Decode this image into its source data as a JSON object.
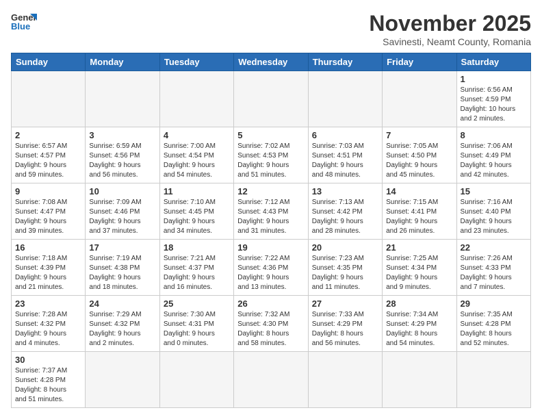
{
  "logo": {
    "line1": "General",
    "line2": "Blue"
  },
  "title": "November 2025",
  "location": "Savinesti, Neamt County, Romania",
  "weekdays": [
    "Sunday",
    "Monday",
    "Tuesday",
    "Wednesday",
    "Thursday",
    "Friday",
    "Saturday"
  ],
  "weeks": [
    [
      {
        "day": "",
        "info": ""
      },
      {
        "day": "",
        "info": ""
      },
      {
        "day": "",
        "info": ""
      },
      {
        "day": "",
        "info": ""
      },
      {
        "day": "",
        "info": ""
      },
      {
        "day": "",
        "info": ""
      },
      {
        "day": "1",
        "info": "Sunrise: 6:56 AM\nSunset: 4:59 PM\nDaylight: 10 hours\nand 2 minutes."
      }
    ],
    [
      {
        "day": "2",
        "info": "Sunrise: 6:57 AM\nSunset: 4:57 PM\nDaylight: 9 hours\nand 59 minutes."
      },
      {
        "day": "3",
        "info": "Sunrise: 6:59 AM\nSunset: 4:56 PM\nDaylight: 9 hours\nand 56 minutes."
      },
      {
        "day": "4",
        "info": "Sunrise: 7:00 AM\nSunset: 4:54 PM\nDaylight: 9 hours\nand 54 minutes."
      },
      {
        "day": "5",
        "info": "Sunrise: 7:02 AM\nSunset: 4:53 PM\nDaylight: 9 hours\nand 51 minutes."
      },
      {
        "day": "6",
        "info": "Sunrise: 7:03 AM\nSunset: 4:51 PM\nDaylight: 9 hours\nand 48 minutes."
      },
      {
        "day": "7",
        "info": "Sunrise: 7:05 AM\nSunset: 4:50 PM\nDaylight: 9 hours\nand 45 minutes."
      },
      {
        "day": "8",
        "info": "Sunrise: 7:06 AM\nSunset: 4:49 PM\nDaylight: 9 hours\nand 42 minutes."
      }
    ],
    [
      {
        "day": "9",
        "info": "Sunrise: 7:08 AM\nSunset: 4:47 PM\nDaylight: 9 hours\nand 39 minutes."
      },
      {
        "day": "10",
        "info": "Sunrise: 7:09 AM\nSunset: 4:46 PM\nDaylight: 9 hours\nand 37 minutes."
      },
      {
        "day": "11",
        "info": "Sunrise: 7:10 AM\nSunset: 4:45 PM\nDaylight: 9 hours\nand 34 minutes."
      },
      {
        "day": "12",
        "info": "Sunrise: 7:12 AM\nSunset: 4:43 PM\nDaylight: 9 hours\nand 31 minutes."
      },
      {
        "day": "13",
        "info": "Sunrise: 7:13 AM\nSunset: 4:42 PM\nDaylight: 9 hours\nand 28 minutes."
      },
      {
        "day": "14",
        "info": "Sunrise: 7:15 AM\nSunset: 4:41 PM\nDaylight: 9 hours\nand 26 minutes."
      },
      {
        "day": "15",
        "info": "Sunrise: 7:16 AM\nSunset: 4:40 PM\nDaylight: 9 hours\nand 23 minutes."
      }
    ],
    [
      {
        "day": "16",
        "info": "Sunrise: 7:18 AM\nSunset: 4:39 PM\nDaylight: 9 hours\nand 21 minutes."
      },
      {
        "day": "17",
        "info": "Sunrise: 7:19 AM\nSunset: 4:38 PM\nDaylight: 9 hours\nand 18 minutes."
      },
      {
        "day": "18",
        "info": "Sunrise: 7:21 AM\nSunset: 4:37 PM\nDaylight: 9 hours\nand 16 minutes."
      },
      {
        "day": "19",
        "info": "Sunrise: 7:22 AM\nSunset: 4:36 PM\nDaylight: 9 hours\nand 13 minutes."
      },
      {
        "day": "20",
        "info": "Sunrise: 7:23 AM\nSunset: 4:35 PM\nDaylight: 9 hours\nand 11 minutes."
      },
      {
        "day": "21",
        "info": "Sunrise: 7:25 AM\nSunset: 4:34 PM\nDaylight: 9 hours\nand 9 minutes."
      },
      {
        "day": "22",
        "info": "Sunrise: 7:26 AM\nSunset: 4:33 PM\nDaylight: 9 hours\nand 7 minutes."
      }
    ],
    [
      {
        "day": "23",
        "info": "Sunrise: 7:28 AM\nSunset: 4:32 PM\nDaylight: 9 hours\nand 4 minutes."
      },
      {
        "day": "24",
        "info": "Sunrise: 7:29 AM\nSunset: 4:32 PM\nDaylight: 9 hours\nand 2 minutes."
      },
      {
        "day": "25",
        "info": "Sunrise: 7:30 AM\nSunset: 4:31 PM\nDaylight: 9 hours\nand 0 minutes."
      },
      {
        "day": "26",
        "info": "Sunrise: 7:32 AM\nSunset: 4:30 PM\nDaylight: 8 hours\nand 58 minutes."
      },
      {
        "day": "27",
        "info": "Sunrise: 7:33 AM\nSunset: 4:29 PM\nDaylight: 8 hours\nand 56 minutes."
      },
      {
        "day": "28",
        "info": "Sunrise: 7:34 AM\nSunset: 4:29 PM\nDaylight: 8 hours\nand 54 minutes."
      },
      {
        "day": "29",
        "info": "Sunrise: 7:35 AM\nSunset: 4:28 PM\nDaylight: 8 hours\nand 52 minutes."
      }
    ],
    [
      {
        "day": "30",
        "info": "Sunrise: 7:37 AM\nSunset: 4:28 PM\nDaylight: 8 hours\nand 51 minutes."
      },
      {
        "day": "",
        "info": ""
      },
      {
        "day": "",
        "info": ""
      },
      {
        "day": "",
        "info": ""
      },
      {
        "day": "",
        "info": ""
      },
      {
        "day": "",
        "info": ""
      },
      {
        "day": "",
        "info": ""
      }
    ]
  ]
}
